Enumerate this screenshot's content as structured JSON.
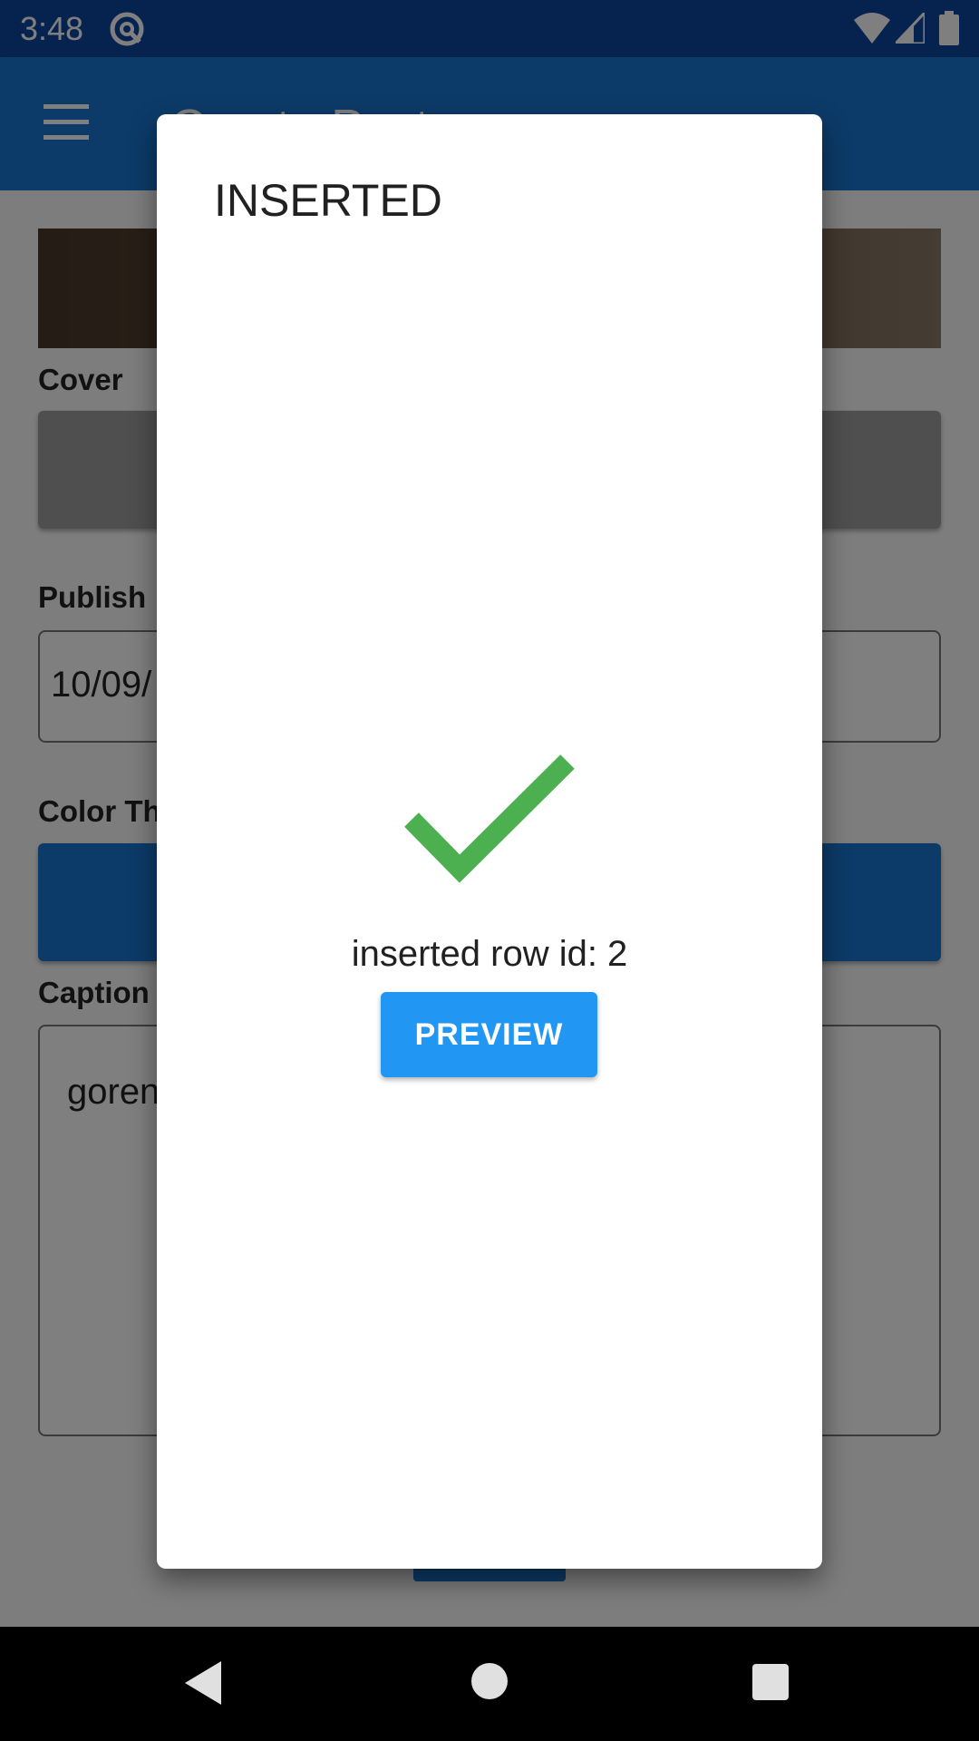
{
  "status_bar": {
    "time": "3:48",
    "icons": [
      "app-notification-icon",
      "wifi-icon",
      "signal-icon",
      "battery-icon"
    ]
  },
  "app_bar": {
    "title": "Create Post",
    "menu_icon": "hamburger-menu-icon",
    "color": "#1976d2"
  },
  "form": {
    "cover_label": "Cover",
    "publish_label": "Publish",
    "publish_value": "10/09/",
    "color_theme_label": "Color Th",
    "caption_label": "Caption",
    "caption_value": "goren"
  },
  "dialog": {
    "title": "INSERTED",
    "icon": "check-icon",
    "icon_color": "#4caf50",
    "message": "inserted row id: 2",
    "preview_label": "PREVIEW",
    "button_color": "#2196f3"
  },
  "nav_bar": {
    "icons": [
      "back-icon",
      "home-icon",
      "recents-icon"
    ]
  }
}
